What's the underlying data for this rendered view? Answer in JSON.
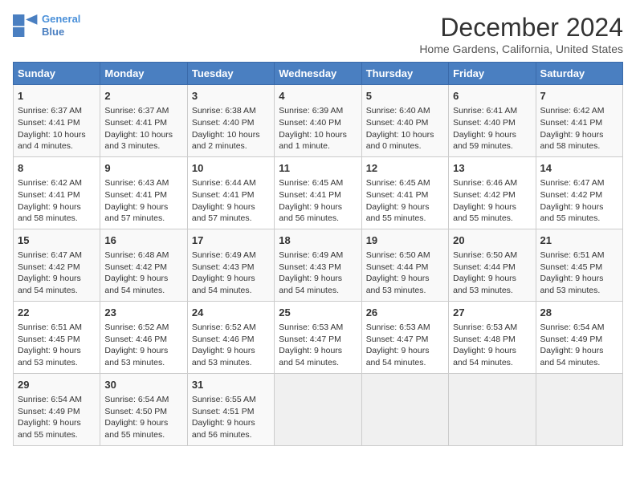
{
  "header": {
    "logo_line1": "General",
    "logo_line2": "Blue",
    "month": "December 2024",
    "location": "Home Gardens, California, United States"
  },
  "weekdays": [
    "Sunday",
    "Monday",
    "Tuesday",
    "Wednesday",
    "Thursday",
    "Friday",
    "Saturday"
  ],
  "weeks": [
    [
      {
        "day": 1,
        "sunrise": "6:37 AM",
        "sunset": "4:41 PM",
        "daylight": "10 hours and 4 minutes."
      },
      {
        "day": 2,
        "sunrise": "6:37 AM",
        "sunset": "4:41 PM",
        "daylight": "10 hours and 3 minutes."
      },
      {
        "day": 3,
        "sunrise": "6:38 AM",
        "sunset": "4:40 PM",
        "daylight": "10 hours and 2 minutes."
      },
      {
        "day": 4,
        "sunrise": "6:39 AM",
        "sunset": "4:40 PM",
        "daylight": "10 hours and 1 minute."
      },
      {
        "day": 5,
        "sunrise": "6:40 AM",
        "sunset": "4:40 PM",
        "daylight": "10 hours and 0 minutes."
      },
      {
        "day": 6,
        "sunrise": "6:41 AM",
        "sunset": "4:40 PM",
        "daylight": "9 hours and 59 minutes."
      },
      {
        "day": 7,
        "sunrise": "6:42 AM",
        "sunset": "4:41 PM",
        "daylight": "9 hours and 58 minutes."
      }
    ],
    [
      {
        "day": 8,
        "sunrise": "6:42 AM",
        "sunset": "4:41 PM",
        "daylight": "9 hours and 58 minutes."
      },
      {
        "day": 9,
        "sunrise": "6:43 AM",
        "sunset": "4:41 PM",
        "daylight": "9 hours and 57 minutes."
      },
      {
        "day": 10,
        "sunrise": "6:44 AM",
        "sunset": "4:41 PM",
        "daylight": "9 hours and 57 minutes."
      },
      {
        "day": 11,
        "sunrise": "6:45 AM",
        "sunset": "4:41 PM",
        "daylight": "9 hours and 56 minutes."
      },
      {
        "day": 12,
        "sunrise": "6:45 AM",
        "sunset": "4:41 PM",
        "daylight": "9 hours and 55 minutes."
      },
      {
        "day": 13,
        "sunrise": "6:46 AM",
        "sunset": "4:42 PM",
        "daylight": "9 hours and 55 minutes."
      },
      {
        "day": 14,
        "sunrise": "6:47 AM",
        "sunset": "4:42 PM",
        "daylight": "9 hours and 55 minutes."
      }
    ],
    [
      {
        "day": 15,
        "sunrise": "6:47 AM",
        "sunset": "4:42 PM",
        "daylight": "9 hours and 54 minutes."
      },
      {
        "day": 16,
        "sunrise": "6:48 AM",
        "sunset": "4:42 PM",
        "daylight": "9 hours and 54 minutes."
      },
      {
        "day": 17,
        "sunrise": "6:49 AM",
        "sunset": "4:43 PM",
        "daylight": "9 hours and 54 minutes."
      },
      {
        "day": 18,
        "sunrise": "6:49 AM",
        "sunset": "4:43 PM",
        "daylight": "9 hours and 54 minutes."
      },
      {
        "day": 19,
        "sunrise": "6:50 AM",
        "sunset": "4:44 PM",
        "daylight": "9 hours and 53 minutes."
      },
      {
        "day": 20,
        "sunrise": "6:50 AM",
        "sunset": "4:44 PM",
        "daylight": "9 hours and 53 minutes."
      },
      {
        "day": 21,
        "sunrise": "6:51 AM",
        "sunset": "4:45 PM",
        "daylight": "9 hours and 53 minutes."
      }
    ],
    [
      {
        "day": 22,
        "sunrise": "6:51 AM",
        "sunset": "4:45 PM",
        "daylight": "9 hours and 53 minutes."
      },
      {
        "day": 23,
        "sunrise": "6:52 AM",
        "sunset": "4:46 PM",
        "daylight": "9 hours and 53 minutes."
      },
      {
        "day": 24,
        "sunrise": "6:52 AM",
        "sunset": "4:46 PM",
        "daylight": "9 hours and 53 minutes."
      },
      {
        "day": 25,
        "sunrise": "6:53 AM",
        "sunset": "4:47 PM",
        "daylight": "9 hours and 54 minutes."
      },
      {
        "day": 26,
        "sunrise": "6:53 AM",
        "sunset": "4:47 PM",
        "daylight": "9 hours and 54 minutes."
      },
      {
        "day": 27,
        "sunrise": "6:53 AM",
        "sunset": "4:48 PM",
        "daylight": "9 hours and 54 minutes."
      },
      {
        "day": 28,
        "sunrise": "6:54 AM",
        "sunset": "4:49 PM",
        "daylight": "9 hours and 54 minutes."
      }
    ],
    [
      {
        "day": 29,
        "sunrise": "6:54 AM",
        "sunset": "4:49 PM",
        "daylight": "9 hours and 55 minutes."
      },
      {
        "day": 30,
        "sunrise": "6:54 AM",
        "sunset": "4:50 PM",
        "daylight": "9 hours and 55 minutes."
      },
      {
        "day": 31,
        "sunrise": "6:55 AM",
        "sunset": "4:51 PM",
        "daylight": "9 hours and 56 minutes."
      },
      null,
      null,
      null,
      null
    ]
  ]
}
